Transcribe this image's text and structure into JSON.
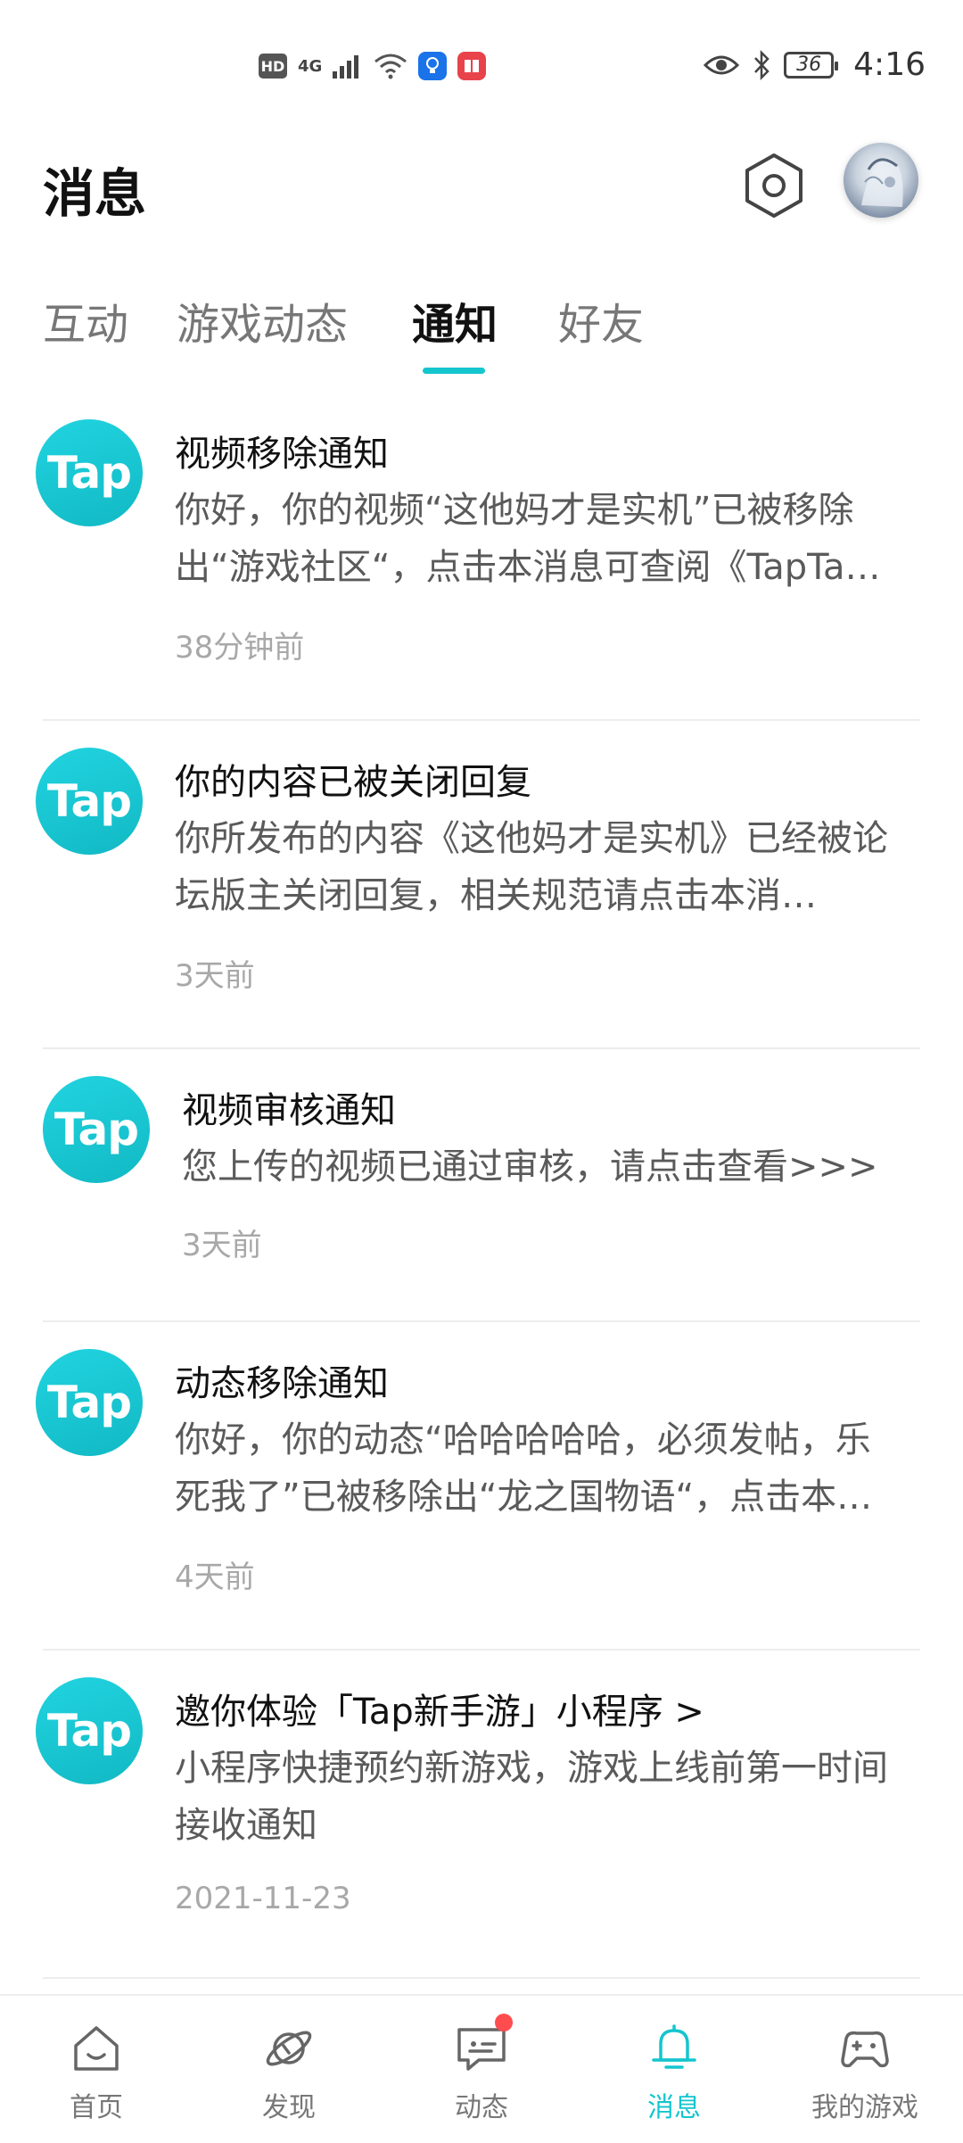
{
  "status_bar": {
    "hd": "HD",
    "network": "4G",
    "battery": "36",
    "time": "4:16"
  },
  "header": {
    "title": "消息"
  },
  "tabs": [
    {
      "label": "互动",
      "active": false
    },
    {
      "label": "游戏动态",
      "active": false
    },
    {
      "label": "通知",
      "active": true
    },
    {
      "label": "好友",
      "active": false
    }
  ],
  "notifications": [
    {
      "avatar_text": "Tap",
      "title": "视频移除通知",
      "desc": "你好，你的视频“这他妈才是实机”已被移除出“游戏社区“，点击本消息可查阅《TapTa…",
      "time": "38分钟前"
    },
    {
      "avatar_text": "Tap",
      "title": "你的内容已被关闭回复",
      "desc": "你所发布的内容《这他妈才是实机》已经被论坛版主关闭回复，相关规范请点击本消…",
      "time": "3天前"
    },
    {
      "avatar_text": "Tap",
      "title": "视频审核通知",
      "desc": "您上传的视频已通过审核，请点击查看>>>",
      "time": "3天前"
    },
    {
      "avatar_text": "Tap",
      "title": "动态移除通知",
      "desc": "你好，你的动态“哈哈哈哈哈，必须发帖，乐死我了”已被移除出“龙之国物语“，点击本…",
      "time": "4天前"
    },
    {
      "avatar_text": "Tap",
      "title": "邀你体验「Tap新手游」小程序 >",
      "desc": "小程序快捷预约新游戏，游戏上线前第一时间接收通知",
      "time": "2021-11-23"
    }
  ],
  "bottom_nav": [
    {
      "label": "首页",
      "icon": "home-icon"
    },
    {
      "label": "发现",
      "icon": "discover-icon"
    },
    {
      "label": "动态",
      "icon": "feed-icon"
    },
    {
      "label": "消息",
      "icon": "bell-icon"
    },
    {
      "label": "我的游戏",
      "icon": "gamepad-icon"
    }
  ],
  "colors": {
    "accent": "#15c5ce",
    "tap_brand": "#11b9c4",
    "badge_red": "#ff4d4f"
  }
}
